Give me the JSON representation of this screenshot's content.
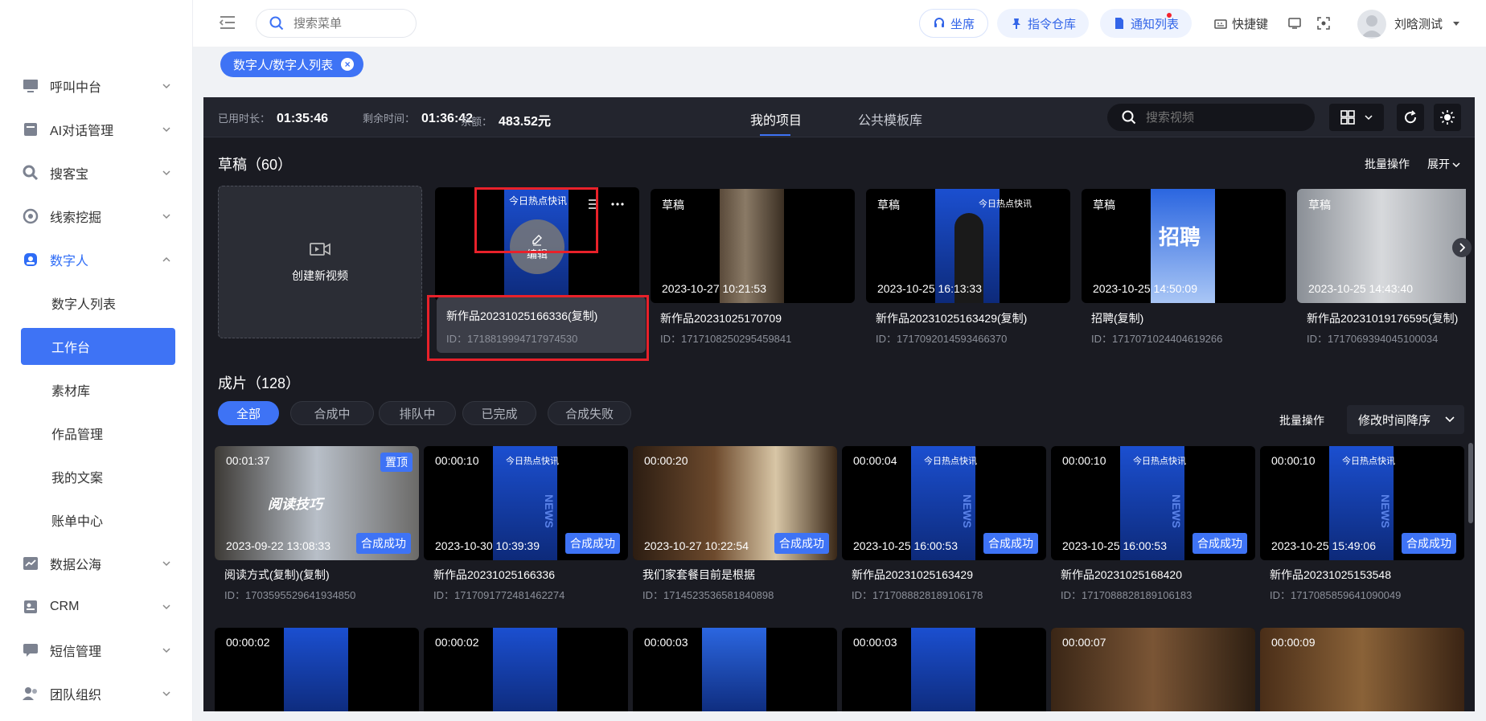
{
  "sidebar": {
    "items": [
      {
        "label": "呼叫中台",
        "icon": "monitor-icon"
      },
      {
        "label": "AI对话管理",
        "icon": "document-icon"
      },
      {
        "label": "搜客宝",
        "icon": "search-customer-icon"
      },
      {
        "label": "线索挖掘",
        "icon": "target-icon"
      },
      {
        "label": "数字人",
        "icon": "digital-human-icon"
      }
    ],
    "sub_items": [
      "数字人列表",
      "工作台",
      "素材库",
      "作品管理",
      "我的文案",
      "账单中心"
    ],
    "items_after": [
      {
        "label": "数据公海",
        "icon": "chart-icon"
      },
      {
        "label": "CRM",
        "icon": "contact-card-icon"
      },
      {
        "label": "短信管理",
        "icon": "message-icon"
      },
      {
        "label": "团队组织",
        "icon": "team-icon"
      }
    ]
  },
  "topbar": {
    "search_placeholder": "搜索菜单",
    "seat_label": "坐席",
    "command_label": "指令仓库",
    "notify_label": "通知列表",
    "shortcut_label": "快捷键",
    "user_name": "刘晗测试"
  },
  "tagbar": {
    "active_tag": "数字人/数字人列表"
  },
  "workspace": {
    "used_label": "已用时长：",
    "used_value": "01:35:46",
    "remain_label": "剩余时间：",
    "remain_value": "01:36:42",
    "balance_label": "余额：",
    "balance_value": "483.52元",
    "tabs": [
      "我的项目",
      "公共模板库"
    ],
    "search_placeholder": "搜索视频"
  },
  "drafts": {
    "title": "草稿（60）",
    "batch_label": "批量操作",
    "expand_label": "展开",
    "create_label": "创建新视频",
    "edit_label": "编辑",
    "hover_card": {
      "title": "新作品20231025166336(复制)",
      "id": "ID：1718819994717974530"
    },
    "cards": [
      {
        "tag": "草稿",
        "date": "2023-10-27 10:21:53",
        "title": "新作品20231025170709",
        "id": "ID：1717108250295459841"
      },
      {
        "tag": "草稿",
        "date": "2023-10-25 16:13:33",
        "title": "新作品20231025163429(复制)",
        "id": "ID：1717092014593466370"
      },
      {
        "tag": "草稿",
        "date": "2023-10-25 14:50:09",
        "title": "招聘(复制)",
        "id": "ID：1717071024404619266"
      },
      {
        "tag": "草稿",
        "date": "2023-10-25 14:43:40",
        "title": "新作品20231019176595(复制)",
        "id": "ID：1717069394045100034"
      }
    ]
  },
  "finished": {
    "title": "成片（128）",
    "filters": [
      "全部",
      "合成中",
      "排队中",
      "已完成",
      "合成失败"
    ],
    "batch_label": "批量操作",
    "sort_label": "修改时间降序",
    "pin_label": "置顶",
    "cards": [
      {
        "duration": "00:01:37",
        "date": "2023-09-22 13:08:33",
        "status": "合成成功",
        "title": "阅读方式(复制)(复制)",
        "id": "ID：1703595529641934850"
      },
      {
        "duration": "00:00:10",
        "date": "2023-10-30 10:39:39",
        "status": "合成成功",
        "title": "新作品20231025166336",
        "id": "ID：1717091772481462274"
      },
      {
        "duration": "00:00:20",
        "date": "2023-10-27 10:22:54",
        "status": "合成成功",
        "title": "我们家套餐目前是根据",
        "id": "ID：1714523536581840898"
      },
      {
        "duration": "00:00:04",
        "date": "2023-10-25 16:00:53",
        "status": "合成成功",
        "title": "新作品20231025163429",
        "id": "ID：1717088828189106178"
      },
      {
        "duration": "00:00:10",
        "date": "2023-10-25 16:00:53",
        "status": "合成成功",
        "title": "新作品20231025168420",
        "id": "ID：1717088828189106183"
      },
      {
        "duration": "00:00:10",
        "date": "2023-10-25 15:49:06",
        "status": "合成成功",
        "title": "新作品20231025153548",
        "id": "ID：1717085859641090049"
      }
    ],
    "row2_durations": [
      "00:00:02",
      "00:00:02",
      "00:00:03",
      "00:00:03",
      "00:00:07",
      "00:00:09"
    ]
  },
  "thumb_text": {
    "news_banner": "今日热点快讯",
    "news_side": "NEWS",
    "recruit": "招聘",
    "reading": "阅读技巧"
  },
  "colors": {
    "accent": "#3e73f5",
    "dark_bg": "#1a1b22",
    "highlight": "#e8212a"
  }
}
